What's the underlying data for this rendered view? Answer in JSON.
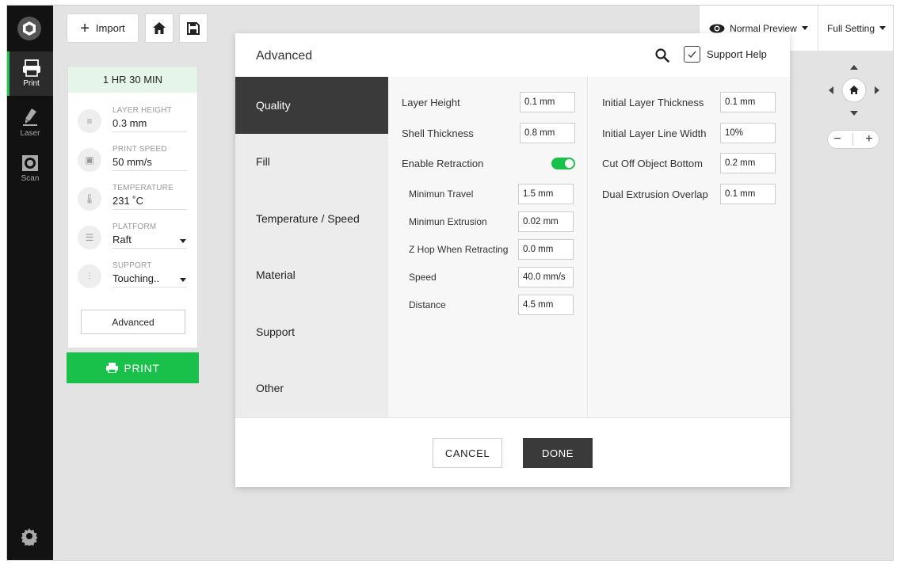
{
  "rail": {
    "items": [
      {
        "label": "Print",
        "icon": "print-icon",
        "active": true
      },
      {
        "label": "Laser",
        "icon": "laser-icon",
        "active": false
      },
      {
        "label": "Scan",
        "icon": "scan-icon",
        "active": false
      }
    ]
  },
  "toolbar": {
    "import_label": "Import",
    "preview_label": "Normal Preview",
    "full_setting_label": "Full Setting"
  },
  "panel": {
    "time": "1 HR 30 MIN",
    "layer_height": {
      "label": "LAYER HEIGHT",
      "value": "0.3 mm"
    },
    "print_speed": {
      "label": "PRINT SPEED",
      "value": "50 mm/s"
    },
    "temperature": {
      "label": "TEMPERATURE",
      "value": "231 ˚C"
    },
    "platform": {
      "label": "PLATFORM",
      "value": "Raft"
    },
    "support": {
      "label": "SUPPORT",
      "value": "Touching.."
    },
    "advanced_label": "Advanced",
    "print_label": "PRINT"
  },
  "modal": {
    "title": "Advanced",
    "support_help": "Support Help",
    "categories": [
      "Quality",
      "Fill",
      "Temperature / Speed",
      "Material",
      "Support",
      "Other"
    ],
    "active_category": "Quality",
    "fields_left": [
      {
        "label": "Layer Height",
        "value": "0.1 mm"
      },
      {
        "label": "Shell Thickness",
        "value": "0.8 mm"
      }
    ],
    "retraction": {
      "label": "Enable Retraction",
      "enabled": true
    },
    "retraction_fields": [
      {
        "label": "Minimun Travel",
        "value": "1.5 mm"
      },
      {
        "label": "Minimun Extrusion",
        "value": "0.02 mm"
      },
      {
        "label": "Z Hop When Retracting",
        "value": "0.0 mm"
      },
      {
        "label": "Speed",
        "value": "40.0 mm/s"
      },
      {
        "label": "Distance",
        "value": "4.5 mm"
      }
    ],
    "fields_right": [
      {
        "label": "Initial Layer Thickness",
        "value": "0.1 mm"
      },
      {
        "label": "Initial Layer Line Width",
        "value": "10%"
      },
      {
        "label": "Cut Off Object Bottom",
        "value": "0.2 mm"
      },
      {
        "label": "Dual Extrusion Overlap",
        "value": "0.1 mm"
      }
    ],
    "cancel_label": "CANCEL",
    "done_label": "DONE"
  },
  "colors": {
    "accent": "#19c04a",
    "dark": "#3a3a3a",
    "rail": "#121212"
  }
}
